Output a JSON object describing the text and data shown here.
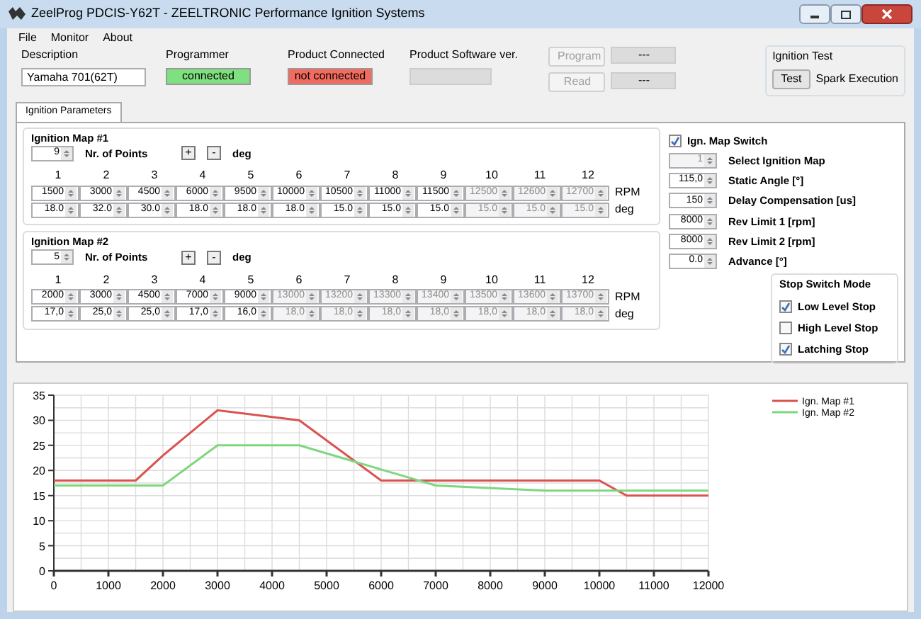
{
  "window": {
    "title": "ZeelProg PDCIS-Y62T - ZEELTRONIC Performance Ignition Systems"
  },
  "menu": [
    "File",
    "Monitor",
    "About"
  ],
  "header": {
    "description": {
      "label": "Description",
      "value": "Yamaha 701(62T)"
    },
    "programmer": {
      "label": "Programmer",
      "status": "connected",
      "connected": true
    },
    "product": {
      "label": "Product Connected",
      "status": "not connected",
      "connected": false
    },
    "software": {
      "label": "Product Software ver."
    },
    "actions": [
      {
        "label": "Program",
        "disabled": true,
        "value": "---"
      },
      {
        "label": "Read",
        "disabled": true,
        "value": "---"
      }
    ],
    "ignition_test": {
      "title": "Ignition Test",
      "button": "Test",
      "label": "Spark Execution"
    }
  },
  "tabs": [
    {
      "label": "Ignition Parameters",
      "selected": true
    }
  ],
  "maps": [
    {
      "title": "Ignition Map #1",
      "points": "9",
      "points_label": "Nr. of Points",
      "plus": "+",
      "minus": "-",
      "unit": "deg",
      "columns": [
        "1",
        "2",
        "3",
        "4",
        "5",
        "6",
        "7",
        "8",
        "9",
        "10",
        "11",
        "12"
      ],
      "rpm_label": "RPM",
      "deg_label": "deg",
      "cells": [
        {
          "rpm": "1500",
          "deg": "18.0",
          "disabled": false
        },
        {
          "rpm": "3000",
          "deg": "32.0",
          "disabled": false
        },
        {
          "rpm": "4500",
          "deg": "30.0",
          "disabled": false
        },
        {
          "rpm": "6000",
          "deg": "18.0",
          "disabled": false
        },
        {
          "rpm": "9500",
          "deg": "18.0",
          "disabled": false
        },
        {
          "rpm": "10000",
          "deg": "18.0",
          "disabled": false
        },
        {
          "rpm": "10500",
          "deg": "15.0",
          "disabled": false
        },
        {
          "rpm": "11000",
          "deg": "15.0",
          "disabled": false
        },
        {
          "rpm": "11500",
          "deg": "15.0",
          "disabled": false
        },
        {
          "rpm": "12500",
          "deg": "15.0",
          "disabled": true
        },
        {
          "rpm": "12600",
          "deg": "15.0",
          "disabled": true
        },
        {
          "rpm": "12700",
          "deg": "15.0",
          "disabled": true
        }
      ]
    },
    {
      "title": "Ignition Map #2",
      "points": "5",
      "points_label": "Nr. of Points",
      "plus": "+",
      "minus": "-",
      "unit": "deg",
      "columns": [
        "1",
        "2",
        "3",
        "4",
        "5",
        "6",
        "7",
        "8",
        "9",
        "10",
        "11",
        "12"
      ],
      "rpm_label": "RPM",
      "deg_label": "deg",
      "cells": [
        {
          "rpm": "2000",
          "deg": "17,0",
          "disabled": false
        },
        {
          "rpm": "3000",
          "deg": "25,0",
          "disabled": false
        },
        {
          "rpm": "4500",
          "deg": "25,0",
          "disabled": false
        },
        {
          "rpm": "7000",
          "deg": "17,0",
          "disabled": false
        },
        {
          "rpm": "9000",
          "deg": "16,0",
          "disabled": false
        },
        {
          "rpm": "13000",
          "deg": "18,0",
          "disabled": true
        },
        {
          "rpm": "13200",
          "deg": "18,0",
          "disabled": true
        },
        {
          "rpm": "13300",
          "deg": "18,0",
          "disabled": true
        },
        {
          "rpm": "13400",
          "deg": "18,0",
          "disabled": true
        },
        {
          "rpm": "13500",
          "deg": "18,0",
          "disabled": true
        },
        {
          "rpm": "13600",
          "deg": "18,0",
          "disabled": true
        },
        {
          "rpm": "13700",
          "deg": "18,0",
          "disabled": true
        }
      ]
    }
  ],
  "settings": {
    "map_switch": {
      "label": "Ign. Map Switch",
      "checked": true
    },
    "fields": [
      {
        "value": "1",
        "label": "Select Ignition Map",
        "disabled": true
      },
      {
        "value": "115,0",
        "label": "Static Angle [°]",
        "disabled": false
      },
      {
        "value": "150",
        "label": "Delay Compensation [us]",
        "disabled": false
      },
      {
        "value": "8000",
        "label": "Rev Limit 1 [rpm]",
        "disabled": false
      },
      {
        "value": "8000",
        "label": "Rev Limit 2 [rpm]",
        "disabled": false
      },
      {
        "value": "0.0",
        "label": "Advance [°]",
        "disabled": false
      }
    ],
    "stop_mode": {
      "title": "Stop Switch Mode",
      "options": [
        {
          "label": "Low Level Stop",
          "checked": true
        },
        {
          "label": "High Level Stop",
          "checked": false
        },
        {
          "label": "Latching Stop",
          "checked": true
        }
      ]
    }
  },
  "chart": {
    "chart_data": {
      "type": "line",
      "x": [
        0,
        1500,
        2000,
        3000,
        4500,
        6000,
        7000,
        9000,
        9500,
        10000,
        10500,
        11000,
        11500,
        12000
      ],
      "series": [
        {
          "name": "Ign. Map #1",
          "color": "#d9534f",
          "values": [
            18,
            18,
            23,
            32,
            30,
            18,
            18,
            18,
            18,
            18,
            15,
            15,
            15,
            15
          ]
        },
        {
          "name": "Ign. Map #2",
          "color": "#7fd67f",
          "values": [
            17,
            17,
            17,
            25,
            25,
            20.2,
            17,
            16,
            16,
            16,
            16,
            16,
            16,
            16
          ]
        }
      ],
      "xlim": [
        0,
        12000
      ],
      "ylim": [
        0,
        35
      ],
      "xticks": [
        {
          "value": 0,
          "label": "0"
        },
        {
          "value": 1000,
          "label": "1000"
        },
        {
          "value": 2000,
          "label": "2000"
        },
        {
          "value": 3000,
          "label": "3000"
        },
        {
          "value": 4000,
          "label": "4000"
        },
        {
          "value": 5000,
          "label": "5000"
        },
        {
          "value": 6000,
          "label": "6000"
        },
        {
          "value": 7000,
          "label": "7000"
        },
        {
          "value": 8000,
          "label": "8000"
        },
        {
          "value": 9000,
          "label": "9000"
        },
        {
          "value": 10000,
          "label": "10000"
        },
        {
          "value": 11000,
          "label": "11000"
        },
        {
          "value": 12000,
          "label": "12000"
        }
      ],
      "yticks": [
        {
          "value": 0,
          "label": "0"
        },
        {
          "value": 5,
          "label": "5"
        },
        {
          "value": 10,
          "label": "10"
        },
        {
          "value": 15,
          "label": "15"
        },
        {
          "value": 20,
          "label": "20"
        },
        {
          "value": 25,
          "label": "25"
        },
        {
          "value": 30,
          "label": "30"
        },
        {
          "value": 35,
          "label": "35"
        }
      ],
      "grid": true,
      "legend": true
    }
  }
}
